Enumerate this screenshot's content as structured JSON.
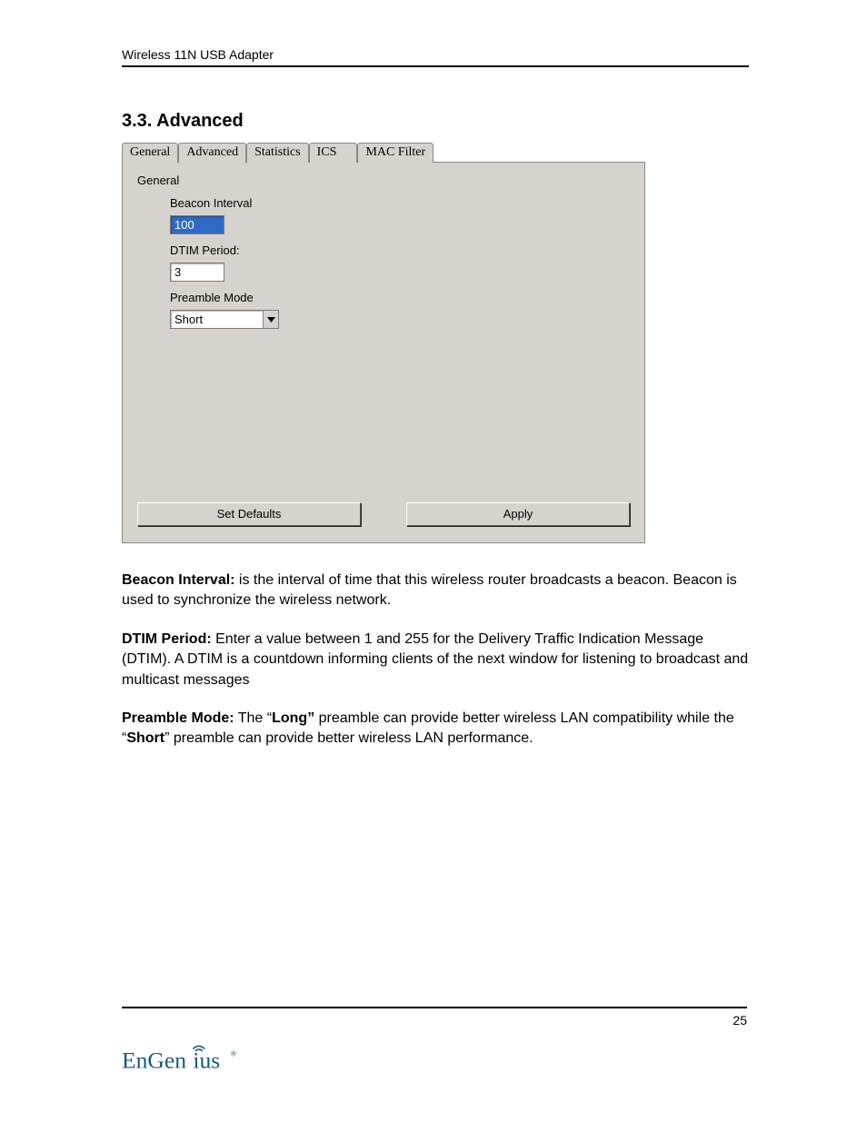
{
  "header": {
    "title": "Wireless 11N USB Adapter"
  },
  "section": {
    "heading": "3.3. Advanced"
  },
  "tabs": {
    "items": [
      {
        "label": "General"
      },
      {
        "label": "Advanced"
      },
      {
        "label": "Statistics"
      },
      {
        "label": "ICS"
      },
      {
        "label": "MAC Filter"
      }
    ]
  },
  "panel": {
    "group_label": "General",
    "beacon": {
      "label": "Beacon Interval",
      "value": "100"
    },
    "dtim": {
      "label": "DTIM Period:",
      "value": "3"
    },
    "preamble": {
      "label": "Preamble Mode",
      "value": "Short"
    },
    "buttons": {
      "defaults": "Set Defaults",
      "apply": "Apply"
    }
  },
  "descriptions": {
    "beacon": {
      "term": "Beacon Interval:",
      "text": " is the interval of time that this wireless router broadcasts a beacon. Beacon is used to synchronize the wireless network."
    },
    "dtim": {
      "term": "DTIM Period:",
      "text": " Enter a value between 1 and 255 for the Delivery Traffic Indication Message (DTIM). A DTIM is a countdown informing clients of the next window for listening to broadcast and multicast messages"
    },
    "preamble": {
      "term": "Preamble Mode:",
      "pre": " The “",
      "long": "Long”",
      "mid": " preamble can provide better wireless LAN compatibility while the “",
      "short": "Short",
      "post": "” preamble can provide better wireless LAN performance."
    }
  },
  "footer": {
    "page": "25",
    "brand": "EnGenius"
  },
  "logo_color": "#1a5a7a"
}
